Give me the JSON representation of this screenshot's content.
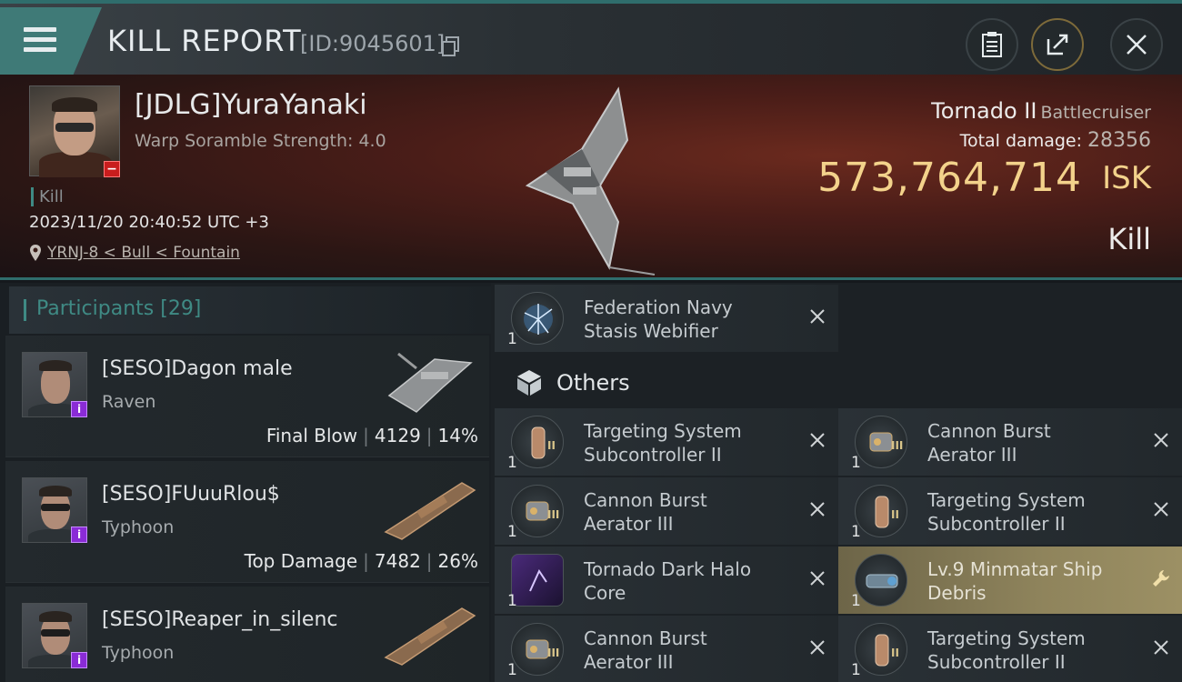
{
  "window": {
    "title": "KILL REPORT",
    "report_id": "[ID:9045601]"
  },
  "victim": {
    "name": "[JDLG]YuraYanaki",
    "scramble": "Warp Soramble Strength: 4.0",
    "status_tag": "Kill",
    "datetime": "2023/11/20 20:40:52 UTC +3",
    "location": "YRNJ-8 < Bull < Fountain",
    "ship_name": "Tornado II",
    "ship_class": "Battlecruiser",
    "total_damage_label": "Total damage:",
    "total_damage_value": "28356",
    "isk_value": "573,764,714",
    "isk_unit": "ISK",
    "result_label": "Kill"
  },
  "participants": {
    "label": "Participants",
    "count": "[29]",
    "rows": [
      {
        "name": "[SESO]Dagon male",
        "ship": "Raven",
        "role": "Final Blow",
        "damage": "4129",
        "percent": "14%"
      },
      {
        "name": "[SESO]FUuuRlou$",
        "ship": "Typhoon",
        "role": "Top Damage",
        "damage": "7482",
        "percent": "26%"
      },
      {
        "name": "[SESO]Reaper_in_silenc",
        "ship": "Typhoon",
        "role": "",
        "damage": "",
        "percent": ""
      }
    ]
  },
  "modules": {
    "top_item": {
      "name_line1": "Federation Navy",
      "name_line2": "Stasis Webifier",
      "qty": "1"
    },
    "others_label": "Others",
    "items": [
      {
        "name_line1": "Targeting System",
        "name_line2": "Subcontroller II",
        "qty": "1",
        "tier": "II",
        "highlight": false
      },
      {
        "name_line1": "Cannon Burst",
        "name_line2": "Aerator III",
        "qty": "1",
        "tier": "III",
        "highlight": false
      },
      {
        "name_line1": "Cannon Burst",
        "name_line2": "Aerator III",
        "qty": "1",
        "tier": "III",
        "highlight": false
      },
      {
        "name_line1": "Targeting System",
        "name_line2": "Subcontroller II",
        "qty": "1",
        "tier": "II",
        "highlight": false
      },
      {
        "name_line1": "Tornado Dark Halo",
        "name_line2": "Core",
        "qty": "1",
        "tier": "",
        "highlight": false
      },
      {
        "name_line1": "Lv.9 Minmatar Ship",
        "name_line2": "Debris",
        "qty": "1",
        "tier": "",
        "highlight": true
      },
      {
        "name_line1": "Cannon Burst",
        "name_line2": "Aerator III",
        "qty": "1",
        "tier": "III",
        "highlight": false
      },
      {
        "name_line1": "Targeting System",
        "name_line2": "Subcontroller II",
        "qty": "1",
        "tier": "II",
        "highlight": false
      }
    ]
  },
  "colors": {
    "accent": "#3f8a84",
    "isk_gold": "#f3d28b",
    "banner_red": "#4a1d18"
  }
}
